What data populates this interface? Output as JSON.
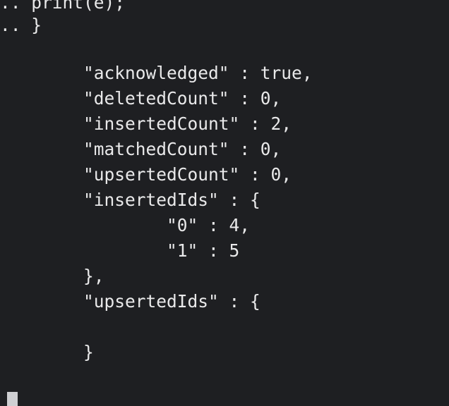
{
  "terminal": {
    "lines": [
      ".. print(e);",
      ".. }",
      "",
      "        \"acknowledged\" : true,",
      "        \"deletedCount\" : 0,",
      "        \"insertedCount\" : 2,",
      "        \"matchedCount\" : 0,",
      "        \"upsertedCount\" : 0,",
      "        \"insertedIds\" : {",
      "                \"0\" : 4,",
      "                \"1\" : 5",
      "        },",
      "        \"upsertedIds\" : {",
      "",
      "        }"
    ]
  }
}
